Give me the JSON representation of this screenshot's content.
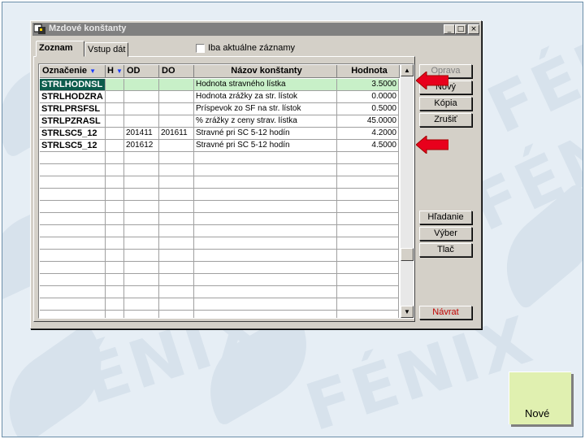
{
  "window": {
    "title": "Mzdové konštanty",
    "minimize_glyph": "_",
    "maximize_glyph": "□",
    "close_glyph": "×"
  },
  "tabs": [
    {
      "label": "Zoznam",
      "active": true
    },
    {
      "label": "Vstup dát",
      "active": false
    }
  ],
  "filter": {
    "label": "Iba aktuálne záznamy",
    "checked": false
  },
  "grid": {
    "columns": [
      {
        "label": "Označenie",
        "sort_arrow": "▼"
      },
      {
        "label": "H",
        "sort_arrow": "▼"
      },
      {
        "label": "OD"
      },
      {
        "label": "DO"
      },
      {
        "label": "Názov konštanty"
      },
      {
        "label": "Hodnota"
      }
    ],
    "rows": [
      {
        "code": "STRLHODNSL",
        "h": "",
        "od": "",
        "do": "",
        "name": "Hodnota stravného lístka",
        "value": "3.5000",
        "selected": true
      },
      {
        "code": "STRLHODZRA",
        "h": "",
        "od": "",
        "do": "",
        "name": "Hodnota zrážky za str. lístok",
        "value": "0.0000"
      },
      {
        "code": "STRLPRSFSL",
        "h": "",
        "od": "",
        "do": "",
        "name": "Príspevok zo SF na str. lístok",
        "value": "0.5000"
      },
      {
        "code": "STRLPZRASL",
        "h": "",
        "od": "",
        "do": "",
        "name": "% zrážky z ceny strav. lístka",
        "value": "45.0000"
      },
      {
        "code": "STRLSC5_12",
        "h": "",
        "od": "201411",
        "do": "201611",
        "name": "Stravné pri SC 5-12 hodín",
        "value": "4.2000"
      },
      {
        "code": "STRLSC5_12",
        "h": "",
        "od": "201612",
        "do": "",
        "name": "Stravné pri SC 5-12 hodín",
        "value": "4.5000"
      }
    ],
    "empty_row_count": 14
  },
  "scrollbar": {
    "up_glyph": "▲",
    "down_glyph": "▼"
  },
  "buttons": {
    "oprava": "Oprava",
    "novy": "Nový",
    "kopia": "Kópia",
    "zrusit": "Zrušiť",
    "hladanie": "Hľadanie",
    "vyber": "Výber",
    "tlac": "Tlač",
    "navrat": "Návrat"
  },
  "sticky_note": {
    "label": "Nové"
  },
  "colors": {
    "selection_row": "#c8f0c8",
    "selection_cell": "#0c5c4c",
    "arrow": "#e8001c",
    "sticky": "#e0f0b0"
  }
}
